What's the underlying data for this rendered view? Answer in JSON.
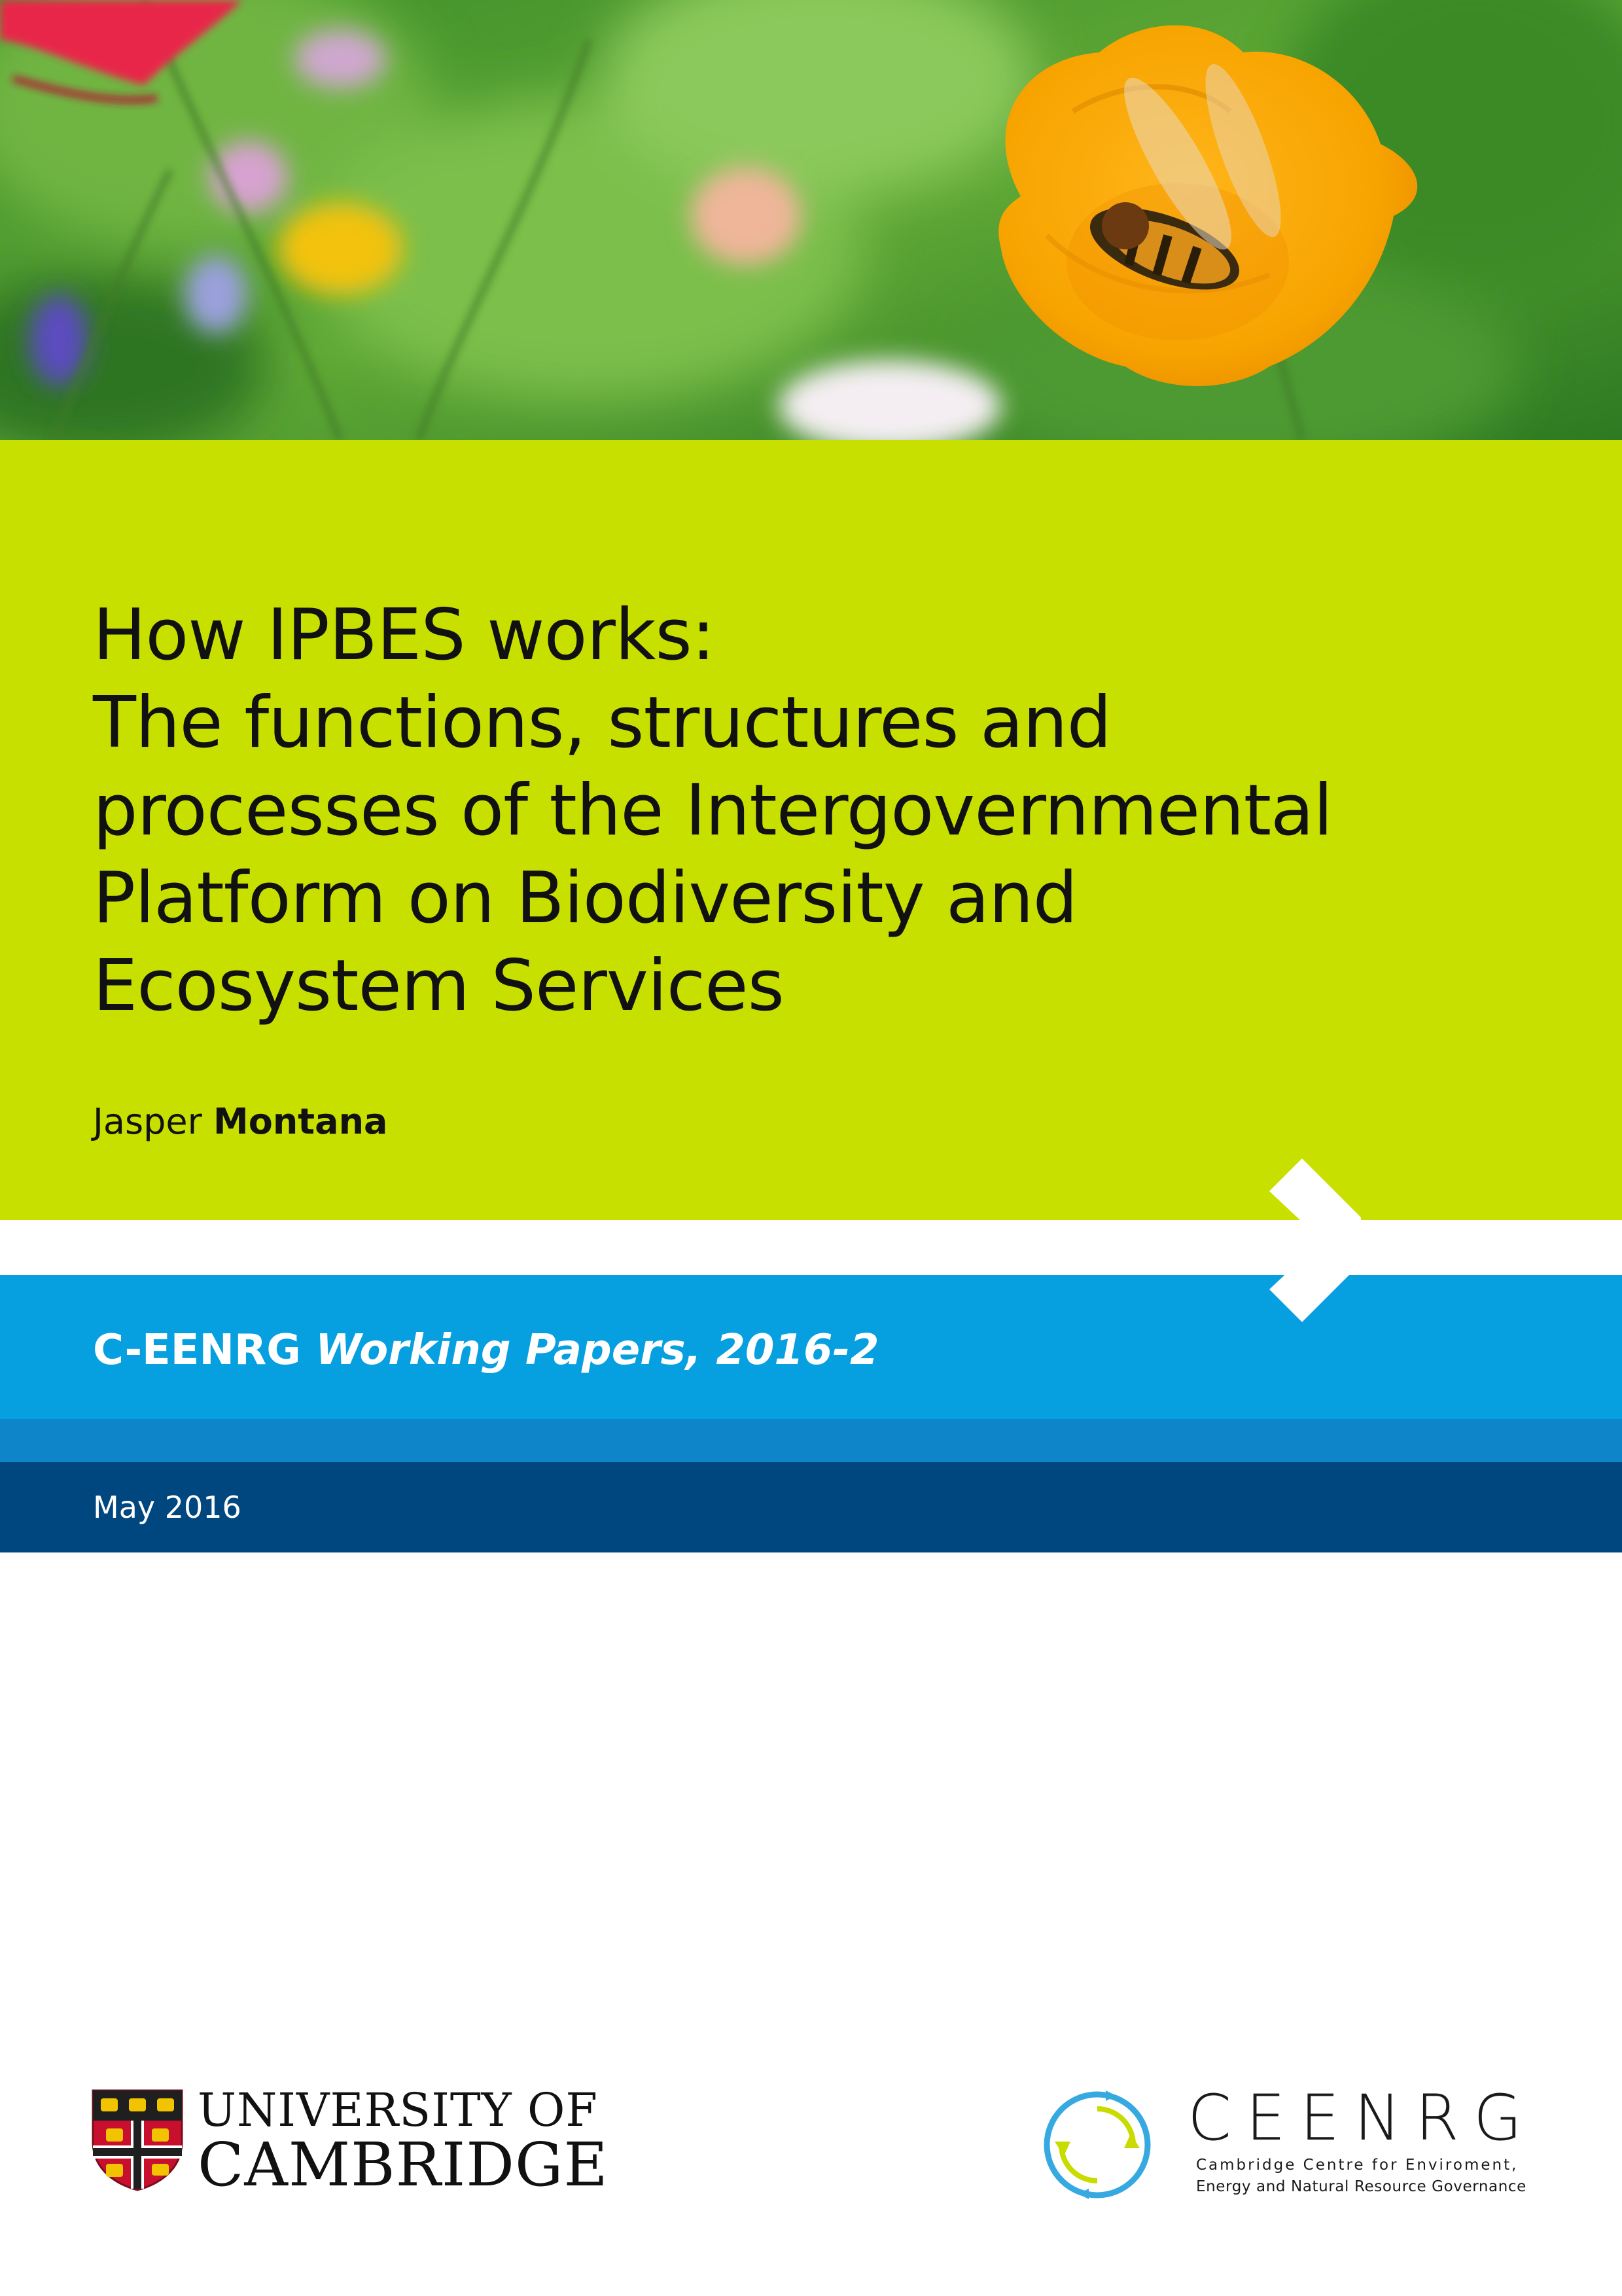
{
  "cover": {
    "title_lines": [
      "How IPBES works:",
      "The functions, structures and",
      "processes of the Intergovernmental",
      "Platform on Biodiversity and",
      "Ecosystem Services"
    ],
    "author": {
      "given_name": "Jasper",
      "surname": "Montana"
    },
    "series": {
      "org": "C-EENRG",
      "name": "Working Papers, 2016-2"
    },
    "date": "May 2016"
  },
  "logos": {
    "university": {
      "line1": "UNIVERSITY OF",
      "line2": "CAMBRIDGE"
    },
    "ceenrg": {
      "name": "CEENRG",
      "subtitle_line1": "Cambridge Centre for Enviroment,",
      "subtitle_line2": "Energy and Natural Resource Governance"
    }
  },
  "colors": {
    "title_band": "#c8e000",
    "series_band": "#069fe0",
    "mid_band": "#0d85c8",
    "date_band": "#00477f"
  },
  "icons": [
    "header-photo",
    "chevron-right-icon",
    "cambridge-shield-icon",
    "ceenrg-circle-icon"
  ]
}
